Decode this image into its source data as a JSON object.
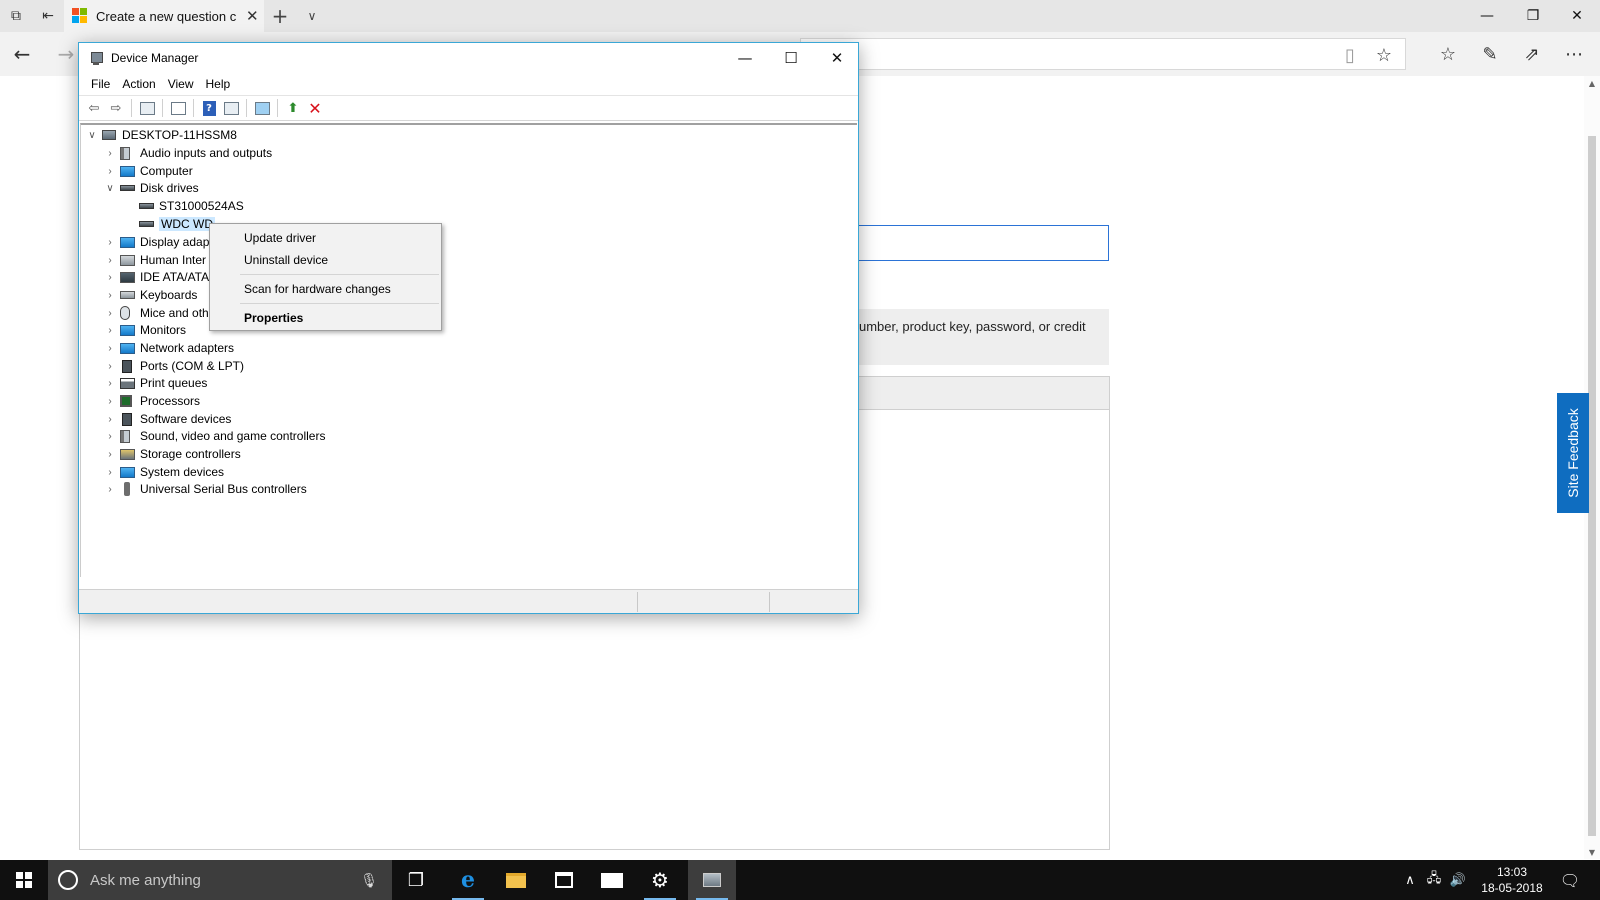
{
  "browser": {
    "tab_title": "Create a new question c",
    "tab_icon": "microsoft-logo-icon",
    "tab_buttons": [
      "tab-preview-icon",
      "set-tabs-aside-icon"
    ],
    "window_controls": [
      "minimize-icon",
      "restore-icon",
      "close-icon"
    ],
    "toolbar_icons": [
      "reading-view-icon",
      "favorite-star-icon",
      "favorites-hub-icon",
      "web-note-icon",
      "share-icon",
      "more-icon"
    ]
  },
  "page": {
    "note_text": "umber, product key, password, or credit",
    "site_feedback": "Site Feedback",
    "accent_color": "#0f6dc0"
  },
  "device_manager": {
    "title": "Device Manager",
    "menus": [
      "File",
      "Action",
      "View",
      "Help"
    ],
    "tree": {
      "root": "DESKTOP-11HSSM8",
      "items": [
        {
          "label": "Audio inputs and outputs",
          "icon": "speaker-icon"
        },
        {
          "label": "Computer",
          "icon": "monitor-icon"
        },
        {
          "label": "Disk drives",
          "icon": "disk-drive-icon",
          "expanded": true
        },
        {
          "label": "ST31000524AS",
          "icon": "disk-drive-icon"
        },
        {
          "label": "WDC WD",
          "icon": "disk-drive-icon",
          "selected": true
        },
        {
          "label": "Display adap",
          "icon": "display-adapter-icon"
        },
        {
          "label": "Human Inter",
          "icon": "hid-icon"
        },
        {
          "label": "IDE ATA/ATA",
          "icon": "ide-controller-icon"
        },
        {
          "label": "Keyboards",
          "icon": "keyboard-icon"
        },
        {
          "label": "Mice and oth",
          "icon": "mouse-icon"
        },
        {
          "label": "Monitors",
          "icon": "monitor-icon"
        },
        {
          "label": "Network adapters",
          "icon": "network-adapter-icon"
        },
        {
          "label": "Ports (COM & LPT)",
          "icon": "port-icon"
        },
        {
          "label": "Print queues",
          "icon": "printer-icon"
        },
        {
          "label": "Processors",
          "icon": "processor-icon"
        },
        {
          "label": "Software devices",
          "icon": "software-device-icon"
        },
        {
          "label": "Sound, video and game controllers",
          "icon": "speaker-icon"
        },
        {
          "label": "Storage controllers",
          "icon": "storage-controller-icon"
        },
        {
          "label": "System devices",
          "icon": "system-device-icon"
        },
        {
          "label": "Universal Serial Bus controllers",
          "icon": "usb-icon"
        }
      ]
    },
    "context_menu": [
      "Update driver",
      "Uninstall device",
      "Scan for hardware changes",
      "Properties"
    ]
  },
  "taskbar": {
    "search_placeholder": "Ask me anything",
    "time": "13:03",
    "date": "18-05-2018",
    "apps": [
      "task-view-icon",
      "edge-icon",
      "file-explorer-icon",
      "store-icon",
      "mail-icon",
      "settings-icon",
      "device-manager-icon"
    ]
  }
}
